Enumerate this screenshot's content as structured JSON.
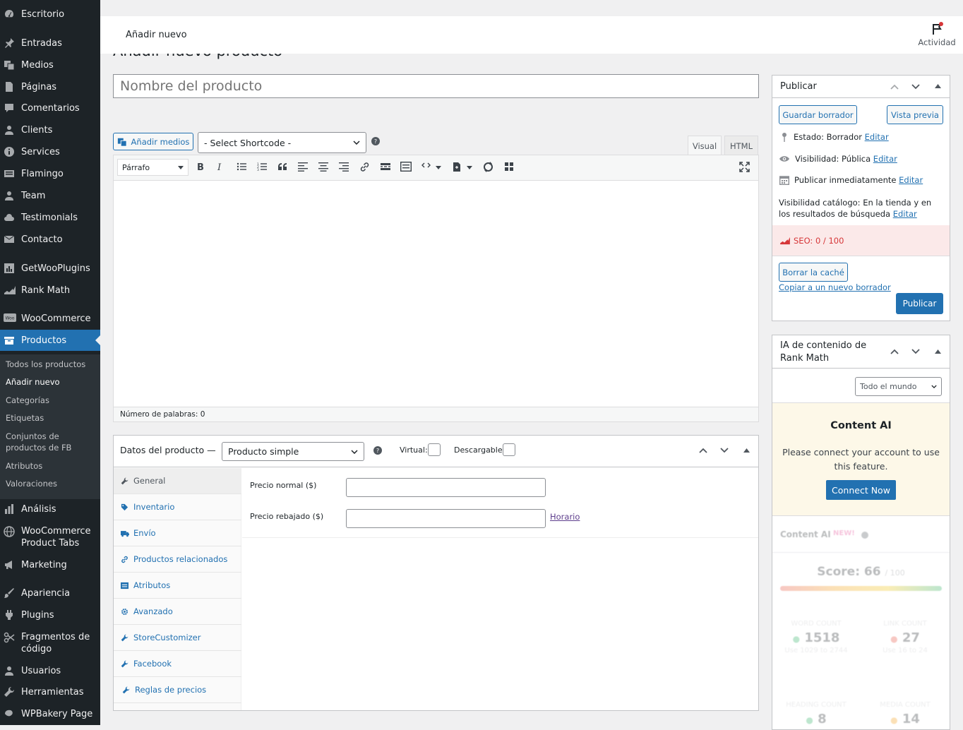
{
  "sidebar": {
    "menu": [
      {
        "label": "Escritorio"
      },
      {
        "label": "Entradas"
      },
      {
        "label": "Medios"
      },
      {
        "label": "Páginas"
      },
      {
        "label": "Comentarios"
      },
      {
        "label": "Clients"
      },
      {
        "label": "Services"
      },
      {
        "label": "Flamingo"
      },
      {
        "label": "Team"
      },
      {
        "label": "Testimonials"
      },
      {
        "label": "Contacto"
      },
      {
        "label": "GetWooPlugins"
      },
      {
        "label": "Rank Math"
      },
      {
        "label": "WooCommerce"
      },
      {
        "label": "Productos"
      },
      {
        "label": "Análisis"
      },
      {
        "label": "WooCommerce Product Tabs"
      },
      {
        "label": "Marketing"
      },
      {
        "label": "Apariencia"
      },
      {
        "label": "Plugins"
      },
      {
        "label": "Fragmentos de código"
      },
      {
        "label": "Usuarios"
      },
      {
        "label": "Herramientas"
      },
      {
        "label": "WPBakery Page"
      }
    ],
    "submenu": [
      {
        "label": "Todos los productos"
      },
      {
        "label": "Añadir nuevo"
      },
      {
        "label": "Categorías"
      },
      {
        "label": "Etiquetas"
      },
      {
        "label": "Conjuntos de productos de FB"
      },
      {
        "label": "Atributos"
      },
      {
        "label": "Valoraciones"
      }
    ]
  },
  "topbar": {
    "title": "Añadir nuevo",
    "activity": "Actividad"
  },
  "page": {
    "heading": "Añadir nuevo producto",
    "title_placeholder": "Nombre del producto"
  },
  "editor": {
    "add_media": "Añadir medios",
    "shortcode_select": "- Select Shortcode -",
    "tab_visual": "Visual",
    "tab_html": "HTML",
    "format_select": "Párrafo",
    "word_count": "Número de palabras: 0"
  },
  "product_data": {
    "label": "Datos del producto —",
    "type": "Producto simple",
    "virtual_label": "Virtual:",
    "downloadable_label": "Descargable:",
    "tabs": [
      {
        "label": "General"
      },
      {
        "label": "Inventario"
      },
      {
        "label": "Envío"
      },
      {
        "label": "Productos relacionados"
      },
      {
        "label": "Atributos"
      },
      {
        "label": "Avanzado"
      },
      {
        "label": "StoreCustomizer"
      },
      {
        "label": "Facebook"
      },
      {
        "label": "Reglas de precios"
      }
    ],
    "regular_price_label": "Precio normal ($)",
    "sale_price_label": "Precio rebajado ($)",
    "schedule_link": "Horario"
  },
  "publish": {
    "title": "Publicar",
    "save_draft": "Guardar borrador",
    "preview": "Vista previa",
    "status": "Estado: Borrador",
    "visibility": "Visibilidad: Pública",
    "publish_time": "Publicar inmediatamente",
    "edit": "Editar",
    "catalog_visibility": "Visibilidad catálogo: En la tienda y en los resultados de búsqueda",
    "seo": "SEO: 0 / 100",
    "clear_cache": "Borrar la caché",
    "copy_draft": "Copiar a un nuevo borrador",
    "publish_button": "Publicar"
  },
  "rankmath_ai": {
    "title": "IA de contenido de Rank Math",
    "region": "Todo el mundo",
    "heading": "Content AI",
    "message": "Please connect your account to use this feature.",
    "connect": "Connect Now",
    "faded_label": "Content AI",
    "faded_badge": "NEW!",
    "score_label": "Score:",
    "score": "66",
    "score_max": "/ 100",
    "stats": [
      {
        "label": "WORD COUNT",
        "value": "1518",
        "hint": "Use 1029 to 2744",
        "color": "#27ae60"
      },
      {
        "label": "LINK COUNT",
        "value": "27",
        "hint": "Use 16 to 24",
        "color": "#e74c3c"
      },
      {
        "label": "HEADING COUNT",
        "value": "8",
        "color": "#27ae60"
      },
      {
        "label": "MEDIA COUNT",
        "value": "14",
        "color": "#f39c12"
      }
    ]
  },
  "colors": {
    "admin_bg": "#1d2327",
    "accent": "#2271b1",
    "seo_bg": "#fbe9e9",
    "ai_bg": "#fdf8e8"
  }
}
